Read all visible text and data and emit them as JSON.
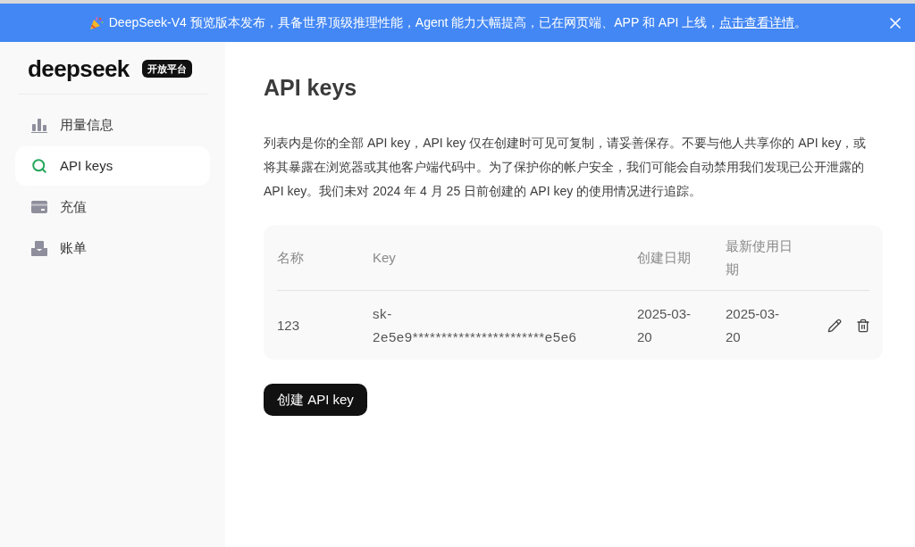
{
  "banner": {
    "text_before": "DeepSeek-V4 预览版本发布，具备世界顶级推理性能，Agent 能力大幅提高，已在网页端、APP 和 API 上线，",
    "link": "点击查看详情",
    "text_after": "。"
  },
  "sidebar": {
    "logo": "deepseek",
    "badge": "开放平台",
    "items": [
      {
        "label": "用量信息",
        "selected": false
      },
      {
        "label": "API keys",
        "selected": true
      },
      {
        "label": "充值",
        "selected": false
      },
      {
        "label": "账单",
        "selected": false
      }
    ]
  },
  "main": {
    "title": "API keys",
    "description": "列表内是你的全部 API key，API key 仅在创建时可见可复制，请妥善保存。不要与他人共享你的 API key，或将其暴露在浏览器或其他客户端代码中。为了保护你的帐户安全，我们可能会自动禁用我们发现已公开泄露的 API key。我们未对 2024 年 4 月 25 日前创建的 API key 的使用情况进行追踪。",
    "table": {
      "columns": [
        "名称",
        "Key",
        "创建日期",
        "最新使用日期"
      ],
      "rows": [
        {
          "name": "123",
          "key": "sk-2e5e9***********************e5e6",
          "created": "2025-03-20",
          "last_used": "2025-03-20"
        }
      ]
    },
    "create_button": "创建 API key"
  }
}
